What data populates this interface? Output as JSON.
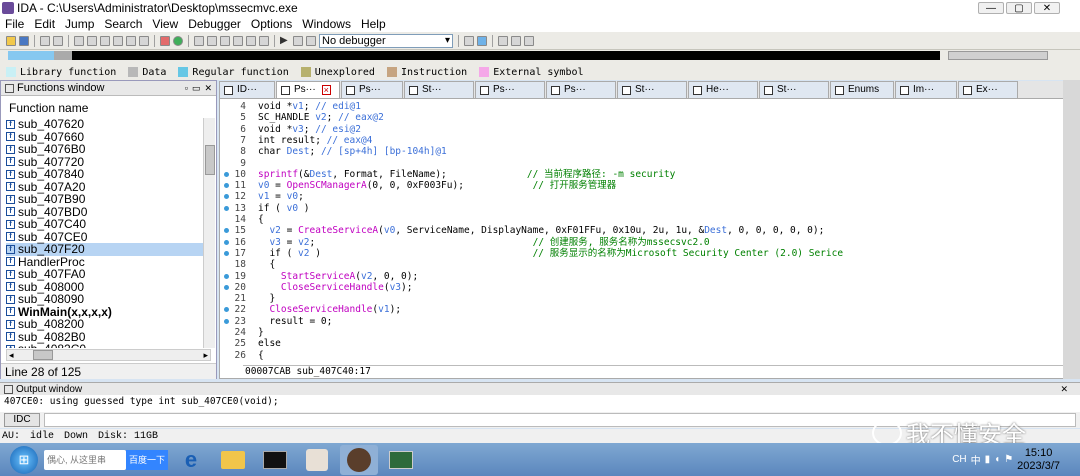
{
  "window": {
    "title": "IDA - C:\\Users\\Administrator\\Desktop\\mssecmvc.exe",
    "min": "—",
    "max": "▢",
    "close": "✕"
  },
  "menu": [
    "File",
    "Edit",
    "Jump",
    "Search",
    "View",
    "Debugger",
    "Options",
    "Windows",
    "Help"
  ],
  "toolbar": {
    "debugger_select": "No debugger"
  },
  "legend": [
    {
      "label": "Library function",
      "color": "#c9f0f5"
    },
    {
      "label": "Data",
      "color": "#b8b8b8"
    },
    {
      "label": "Regular function",
      "color": "#66c7e5"
    },
    {
      "label": "Unexplored",
      "color": "#b7b16d"
    },
    {
      "label": "Instruction",
      "color": "#c6a480"
    },
    {
      "label": "External symbol",
      "color": "#f5a8e8"
    }
  ],
  "functions_window": {
    "title": "Functions window",
    "column": "Function name",
    "items": [
      {
        "name": "sub_407620"
      },
      {
        "name": "sub_407660"
      },
      {
        "name": "sub_4076B0"
      },
      {
        "name": "sub_407720"
      },
      {
        "name": "sub_407840"
      },
      {
        "name": "sub_407A20"
      },
      {
        "name": "sub_407B90"
      },
      {
        "name": "sub_407BD0"
      },
      {
        "name": "sub_407C40"
      },
      {
        "name": "sub_407CE0"
      },
      {
        "name": "sub_407F20"
      },
      {
        "name": "HandlerProc"
      },
      {
        "name": "sub_407FA0"
      },
      {
        "name": "sub_408000"
      },
      {
        "name": "sub_408090"
      },
      {
        "name": "WinMain(x,x,x,x)"
      },
      {
        "name": "sub_408200"
      },
      {
        "name": "sub_4082B0"
      },
      {
        "name": "sub_4082C0"
      }
    ],
    "selected_index": 10,
    "bold_index": 15,
    "status": "Line 28 of 125"
  },
  "tabs": [
    {
      "label": "ID···"
    },
    {
      "label": "Ps···",
      "active": true
    },
    {
      "label": "Ps···"
    },
    {
      "label": "St···"
    },
    {
      "label": "Ps···"
    },
    {
      "label": "Ps···"
    },
    {
      "label": "St···"
    },
    {
      "label": "He···"
    },
    {
      "label": "St···"
    },
    {
      "label": "Enums"
    },
    {
      "label": "Im···"
    },
    {
      "label": "Ex···"
    }
  ],
  "code": [
    {
      "n": "4",
      "dot": false,
      "t": "void *v1; // edi@1"
    },
    {
      "n": "5",
      "dot": false,
      "t": "SC_HANDLE v2; // eax@2"
    },
    {
      "n": "6",
      "dot": false,
      "t": "void *v3; // esi@2"
    },
    {
      "n": "7",
      "dot": false,
      "t": "int result; // eax@4"
    },
    {
      "n": "8",
      "dot": false,
      "t": "char Dest; // [sp+4h] [bp-104h]@1"
    },
    {
      "n": "9",
      "dot": false,
      "t": ""
    },
    {
      "n": "10",
      "dot": true,
      "t": "sprintf(&Dest, Format, FileName);              // 当前程序路径: -m security"
    },
    {
      "n": "11",
      "dot": true,
      "t": "v0 = OpenSCManagerA(0, 0, 0xF003Fu);            // 打开服务管理器"
    },
    {
      "n": "12",
      "dot": true,
      "t": "v1 = v0;"
    },
    {
      "n": "13",
      "dot": true,
      "t": "if ( v0 )"
    },
    {
      "n": "14",
      "dot": false,
      "t": "{"
    },
    {
      "n": "15",
      "dot": true,
      "t": "  v2 = CreateServiceA(v0, ServiceName, DisplayName, 0xF01FFu, 0x10u, 2u, 1u, &Dest, 0, 0, 0, 0, 0);"
    },
    {
      "n": "16",
      "dot": true,
      "t": "  v3 = v2;                                      // 创建服务, 服务名称为mssecsvc2.0"
    },
    {
      "n": "17",
      "dot": true,
      "t": "  if ( v2 )                                     // 服务显示的名称为Microsoft Security Center (2.0) Serice"
    },
    {
      "n": "18",
      "dot": false,
      "t": "  {"
    },
    {
      "n": "19",
      "dot": true,
      "t": "    StartServiceA(v2, 0, 0);"
    },
    {
      "n": "20",
      "dot": true,
      "t": "    CloseServiceHandle(v3);"
    },
    {
      "n": "21",
      "dot": false,
      "t": "  }"
    },
    {
      "n": "22",
      "dot": true,
      "t": "  CloseServiceHandle(v1);"
    },
    {
      "n": "23",
      "dot": true,
      "t": "  result = 0;"
    },
    {
      "n": "24",
      "dot": false,
      "t": "}"
    },
    {
      "n": "25",
      "dot": false,
      "t": "else"
    },
    {
      "n": "26",
      "dot": false,
      "t": "{"
    }
  ],
  "code_status": "00007CAB sub_407C40:17",
  "output": {
    "title": "Output window",
    "text": "407CE0: using guessed type int sub_407CE0(void);",
    "idc": "IDC"
  },
  "statusbar": {
    "au": "AU:",
    "state": "idle",
    "dir": "Down",
    "disk": "Disk: 11GB"
  },
  "taskbar": {
    "search_placeholder": "偶心, 从这里串",
    "baidu": "百度一下",
    "ime": "CH",
    "ime2": "中",
    "time": "15:10",
    "date": "2023/3/7"
  },
  "watermark": "我不懂安全"
}
